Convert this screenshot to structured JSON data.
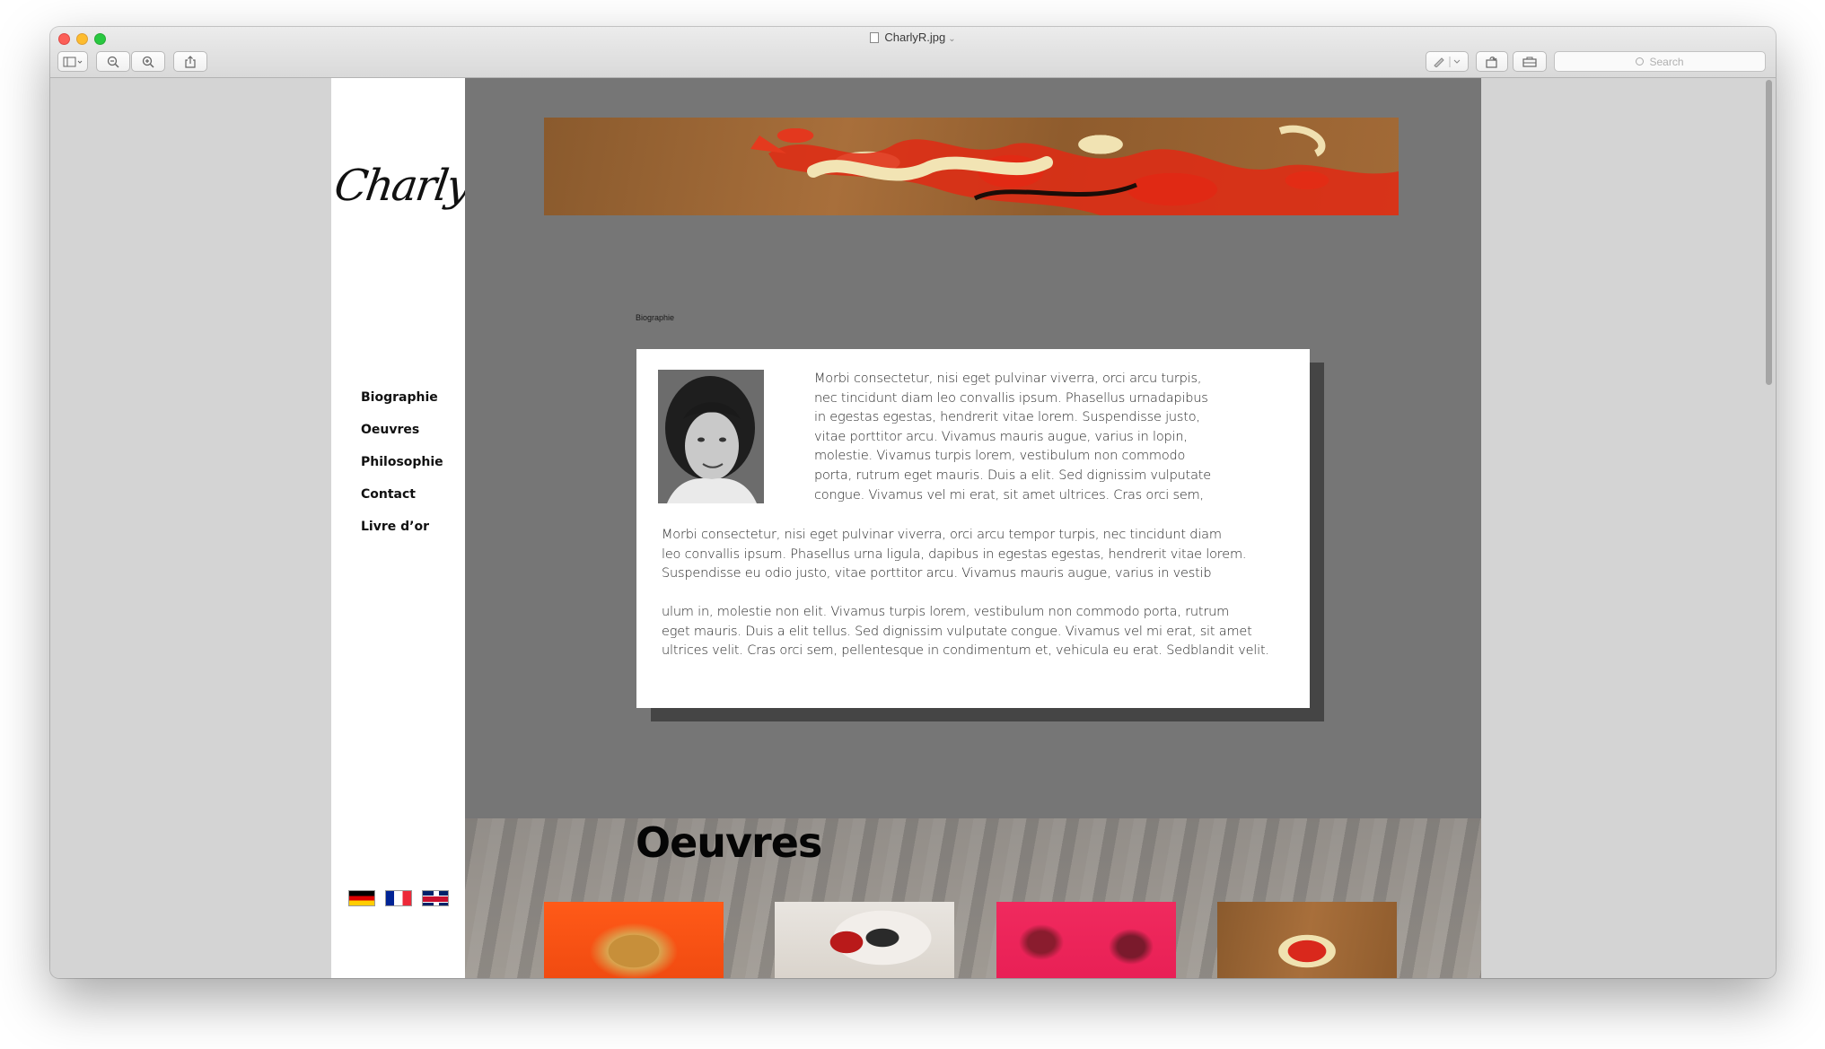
{
  "window": {
    "title": "CharlyR.jpg",
    "search_placeholder": "Search"
  },
  "site": {
    "logo": "CharlyR",
    "nav": [
      "Biographie",
      "Oeuvres",
      "Philosophie",
      "Contact",
      "Livre d’or"
    ],
    "flags": [
      "german-flag",
      "french-flag",
      "uk-flag"
    ]
  },
  "bio": {
    "section_label": "Biographie",
    "paragraph_1": "Morbi consectetur, nisi eget pulvinar viverra, orci arcu turpis,\nnec tincidunt diam leo convallis ipsum. Phasellus urnadapibus\nin egestas egestas, hendrerit vitae lorem. Suspendisse justo,\nvitae porttitor arcu. Vivamus mauris augue, varius in lopin,\nmolestie. Vivamus turpis lorem, vestibulum non commodo\nporta, rutrum eget mauris. Duis a elit. Sed dignissim vulputate\ncongue. Vivamus vel mi erat, sit amet ultrices. Cras orci sem,",
    "paragraph_2": "Morbi consectetur, nisi eget pulvinar viverra, orci arcu tempor turpis, nec tincidunt diam\nleo convallis ipsum. Phasellus urna ligula, dapibus in egestas egestas, hendrerit vitae lorem.\nSuspendisse eu odio justo, vitae porttitor arcu. Vivamus mauris augue, varius in vestib",
    "paragraph_3": "ulum in, molestie non elit. Vivamus turpis lorem, vestibulum non commodo porta, rutrum\neget mauris. Duis a elit tellus. Sed dignissim vulputate congue. Vivamus vel mi erat, sit amet\n ultrices velit. Cras orci sem, pellentesque in condimentum et, vehicula eu erat. Sedblandit velit."
  },
  "oeuvres": {
    "title": "Oeuvres",
    "thumbnails": [
      "painting-orange",
      "painting-white-red",
      "painting-pink",
      "painting-brown-red"
    ]
  },
  "colors": {
    "main_bg": "#767676",
    "sidebar_bg": "#ffffff",
    "card_bg": "#ffffff",
    "card_shadow": "#454545"
  }
}
